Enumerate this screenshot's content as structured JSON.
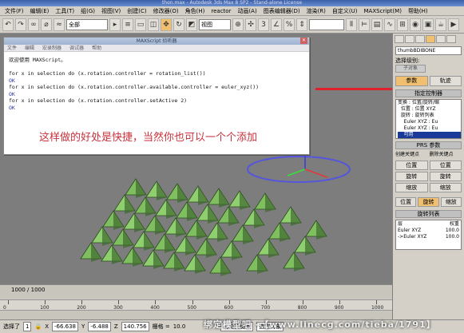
{
  "window_title": "thon.max - Autodesk 3ds Max 8 SP2 - Stand-alone License",
  "menu": [
    "文件(F)",
    "编辑(E)",
    "工具(T)",
    "组(G)",
    "视图(V)",
    "创建(C)",
    "修改器(O)",
    "角色(H)",
    "reactor",
    "动画(A)",
    "图表编辑器(D)",
    "渲染(R)",
    "自定义(U)",
    "MAXScript(M)",
    "帮助(H)"
  ],
  "toolbar": {
    "selection_filter": "全部",
    "view_label": "视图"
  },
  "script_window": {
    "title": "MAXScript 侦听器",
    "menu": [
      "文件",
      "编辑",
      "宏录制器",
      "调试器",
      "帮助"
    ],
    "lines": [
      {
        "text": "欢迎使用 MAXScript。",
        "ok": false
      },
      {
        "text": "",
        "ok": false
      },
      {
        "text": "for x in selection do (x.rotation.controller = rotation_list())",
        "ok": false
      },
      {
        "text": "OK",
        "ok": true
      },
      {
        "text": "for x in selection do (x.rotation.controller.available.controller = euler_xyz())",
        "ok": false
      },
      {
        "text": "OK",
        "ok": true
      },
      {
        "text": "for x in selection do (x.rotation.controller.setActive 2)",
        "ok": false
      },
      {
        "text": "OK",
        "ok": true
      }
    ]
  },
  "annotation": "这样做的好处是快捷，当然你也可以一个个添加",
  "timeline": {
    "frame_label": "1000 / 1000",
    "ticks": [
      "0",
      "100",
      "200",
      "300",
      "400",
      "500",
      "600",
      "700",
      "800",
      "900",
      "1000"
    ]
  },
  "status": {
    "selected": "选择了",
    "selected_count": "1",
    "x_label": "X",
    "x": "-66.638",
    "y_label": "Y",
    "y": "-6.488",
    "z_label": "Z",
    "z": "140.756",
    "grid_label": "栅格 =",
    "grid": "10.0",
    "autokey": "自动关键点",
    "select_obj": "选定对象"
  },
  "watermark": "绑定模型吧 -【www.linecg.com/tieba/1791】",
  "command_panel": {
    "object_name": "thumbBDIBONE",
    "selection_level_label": "选择级别:",
    "sub_object": "子对象",
    "tabs": [
      "参数",
      "轨迹"
    ],
    "assign_controller": "指定控制器",
    "tree": [
      {
        "text": "变换 : 位置/旋转/缩",
        "hl": false
      },
      {
        "text": "  位置 : 位置 XYZ",
        "hl": false
      },
      {
        "text": "  旋转 : 旋转列表",
        "hl": false
      },
      {
        "text": "    Euler XYZ : Eu",
        "hl": false
      },
      {
        "text": "    Euler XYZ : Eu",
        "hl": false
      },
      {
        "text": "    可用",
        "hl": true
      },
      {
        "text": "  权重",
        "hl": false
      }
    ],
    "pbs_section": "PRS 参数",
    "create_key": "创建关键点",
    "delete_key": "删除关键点",
    "key_buttons": [
      "位置",
      "位置",
      "旋转",
      "旋转",
      "缩放",
      "缩放"
    ],
    "bottom_tabs": [
      "位置",
      "旋转",
      "缩放"
    ],
    "rotation_list_section": "旋转列表",
    "list_header": {
      "layer": "层",
      "weight": "权重"
    },
    "list_rows": [
      {
        "name": "Euler XYZ",
        "weight": "100.0"
      },
      {
        "name": "->Euler XYZ",
        "weight": "100.0"
      }
    ]
  },
  "colors": {
    "annotation": "#c8323c",
    "redline": "#e0202a",
    "viewport_bg": "#7d7d7d",
    "mesh": "#7fbf5f"
  }
}
